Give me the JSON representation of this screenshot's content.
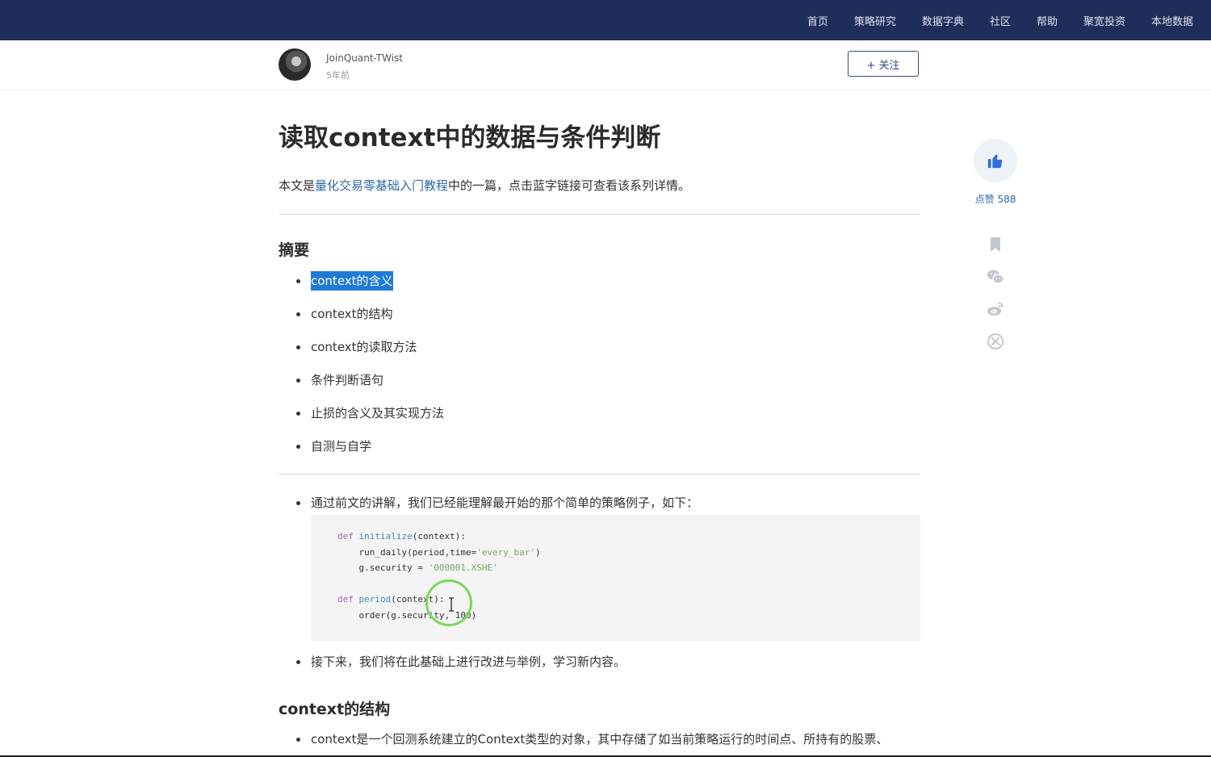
{
  "nav": {
    "items": [
      "首页",
      "策略研究",
      "数据字典",
      "社区",
      "帮助",
      "聚宽投资",
      "本地数据"
    ]
  },
  "author": {
    "name": "JoinQuant-TWist",
    "time": "5年前",
    "follow_label": "+ 关注"
  },
  "article": {
    "title": "读取context中的数据与条件判断",
    "intro_prefix": "本文是",
    "intro_link": "量化交易零基础入门教程",
    "intro_suffix": "中的一篇，点击蓝字链接可查看该系列详情。",
    "summary_heading": "摘要",
    "summary_items": [
      "context的含义",
      "context的结构",
      "context的读取方法",
      "条件判断语句",
      "止损的含义及其实现方法",
      "自测与自学"
    ],
    "para1": "通过前文的讲解，我们已经能理解最开始的那个简单的策略例子，如下：",
    "code": {
      "l1_kw": "def",
      "l1_fn": "initialize",
      "l1_rest": "(context):",
      "l2_a": "    run_daily(period,time=",
      "l2_str": "'every_bar'",
      "l2_b": ")",
      "l3_a": "    g.security = ",
      "l3_str": "'000001.XSHE'",
      "l5_kw": "def",
      "l5_fn": "period",
      "l5_rest": "(context):",
      "l6": "    order(g.security, 100)"
    },
    "para2": "接下来，我们将在此基础上进行改进与举例，学习新内容。",
    "section2_heading": "context的结构",
    "para3": "context是一个回测系统建立的Context类型的对象，其中存储了如当前策略运行的时间点、所持有的股票、"
  },
  "side": {
    "like_label": "点赞 588",
    "icons": [
      "thumbs-up-icon",
      "bookmark-icon",
      "wechat-icon",
      "weibo-icon",
      "share-icon"
    ]
  },
  "colors": {
    "nav_bg": "#1f2d5a",
    "link": "#2d6aa8",
    "selection": "#1f7ad6",
    "cursor_ring": "#7bd85d"
  }
}
